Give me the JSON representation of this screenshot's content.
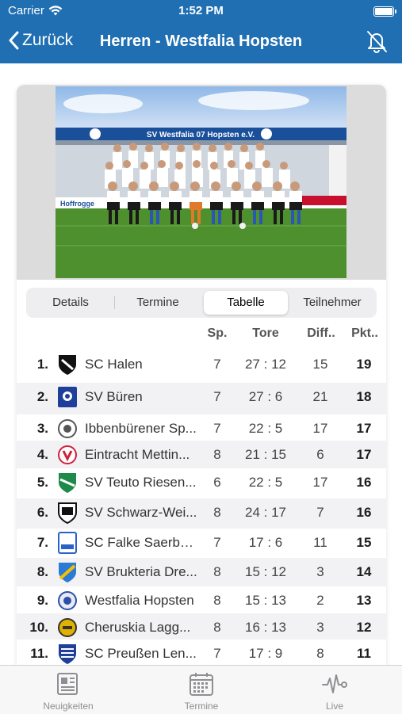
{
  "status": {
    "carrier": "Carrier",
    "time": "1:52 PM"
  },
  "nav": {
    "back_label": "Zurück",
    "title": "Herren - Westfalia Hopsten"
  },
  "photo": {
    "banner_text": "SV Westfalia 07 Hopsten e.V.",
    "board_text": "Hoffrogge"
  },
  "segments": [
    {
      "label": "Details",
      "selected": false
    },
    {
      "label": "Termine",
      "selected": false
    },
    {
      "label": "Tabelle",
      "selected": true
    },
    {
      "label": "Teilnehmer",
      "selected": false
    }
  ],
  "table": {
    "headers": {
      "sp": "Sp.",
      "tore": "Tore",
      "diff": "Diff..",
      "pkt": "Pkt.."
    },
    "rows": [
      {
        "rank": "1.",
        "team": "SC Halen",
        "sp": "7",
        "tore": "27 : 12",
        "diff": "15",
        "pkt": "19",
        "logo_color": "#111111"
      },
      {
        "rank": "2.",
        "team": "SV Büren",
        "sp": "7",
        "tore": "27 : 6",
        "diff": "21",
        "pkt": "18",
        "logo_color": "#1f3f9a"
      },
      {
        "rank": "3.",
        "team": "Ibbenbürener Sp...",
        "sp": "7",
        "tore": "22 : 5",
        "diff": "17",
        "pkt": "17",
        "logo_color": "#555555"
      },
      {
        "rank": "4.",
        "team": "Eintracht Mettin...",
        "sp": "8",
        "tore": "21 : 15",
        "diff": "6",
        "pkt": "17",
        "logo_color": "#d0213a"
      },
      {
        "rank": "5.",
        "team": "SV Teuto Riesen...",
        "sp": "6",
        "tore": "22 : 5",
        "diff": "17",
        "pkt": "16",
        "logo_color": "#1e8a4a"
      },
      {
        "rank": "6.",
        "team": "SV Schwarz-Wei...",
        "sp": "8",
        "tore": "24 : 17",
        "diff": "7",
        "pkt": "16",
        "logo_color": "#111111"
      },
      {
        "rank": "7.",
        "team": "SC Falke Saerbe...",
        "sp": "7",
        "tore": "17 : 6",
        "diff": "11",
        "pkt": "15",
        "logo_color": "#2a62c8"
      },
      {
        "rank": "8.",
        "team": "SV Brukteria Dre...",
        "sp": "8",
        "tore": "15 : 12",
        "diff": "3",
        "pkt": "14",
        "logo_color": "#2a7ad6"
      },
      {
        "rank": "9.",
        "team": "Westfalia Hopsten",
        "sp": "8",
        "tore": "15 : 13",
        "diff": "2",
        "pkt": "13",
        "logo_color": "#2c4fa8"
      },
      {
        "rank": "10.",
        "team": "Cheruskia Lagg...",
        "sp": "8",
        "tore": "16 : 13",
        "diff": "3",
        "pkt": "12",
        "logo_color": "#e0b100"
      },
      {
        "rank": "11.",
        "team": "SC Preußen Len...",
        "sp": "7",
        "tore": "17 : 9",
        "diff": "8",
        "pkt": "11",
        "logo_color": "#1f3f9a"
      }
    ]
  },
  "tabbar": [
    {
      "label": "Neuigkeiten",
      "icon": "newspaper-icon"
    },
    {
      "label": "Termine",
      "icon": "calendar-icon"
    },
    {
      "label": "Live",
      "icon": "pulse-icon"
    }
  ],
  "colors": {
    "brand": "#1f6fb2",
    "alt_row": "#f2f2f4",
    "tab_inactive": "#8e8e93"
  }
}
